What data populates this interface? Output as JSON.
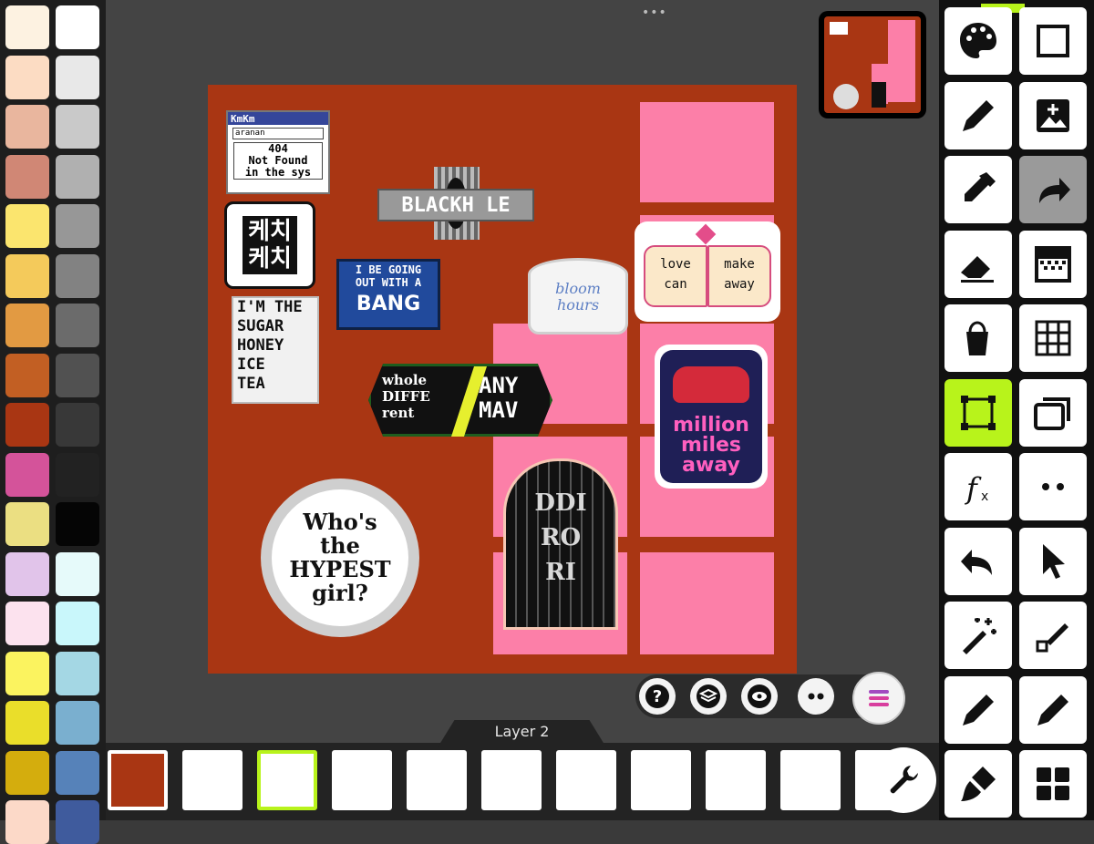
{
  "palette": {
    "colors_left": [
      "#fdf2e1",
      "#fcdcc3",
      "#e9b69e",
      "#d08775",
      "#fbe56e",
      "#f4ca5b",
      "#e29a42",
      "#c25f23",
      "#a93613",
      "#d4539a",
      "#ebdf82",
      "#e1c4ea",
      "#fce2ee",
      "#fbf35f",
      "#eade2a",
      "#d4ad0d",
      "#fcd9c8"
    ],
    "colors_right": [
      "#ffffff",
      "#e8e8e8",
      "#c9c9c9",
      "#b0b0b0",
      "#979797",
      "#828282",
      "#6b6b6b",
      "#515151",
      "#383838",
      "#222222",
      "#050505",
      "#e6fafa",
      "#c9f7fb",
      "#a4d7e4",
      "#7aafcf",
      "#5682b9",
      "#3f5b9d"
    ]
  },
  "canvas": {
    "background": "#a93613",
    "stickers": {
      "window_title": "KmKm",
      "window_field": "aranan",
      "window_text": "404\nNot Found\nin the sys",
      "kechi": "케치\n케치",
      "blackhole": "BLACKH LE",
      "bang_top": "I BE GOING\nOUT WITH A",
      "bang_word": "BANG",
      "sugar": "I'M THE\nSUGAR\nHONEY\nICE\nTEA",
      "whole": "whole\nDIFFE\nrent",
      "anymav": "ANY\nMAV",
      "bloom": "bloom\nhours",
      "book_left": "love\ncan",
      "book_right": "make\naway",
      "million": "million\nmiles\naway",
      "hypest": "Who's\nthe\nHYPEST\ngirl?",
      "gate": "DDI\nRO\nRI"
    }
  },
  "layers": {
    "current_name": "Layer 2",
    "thumbnails": [
      "layer-1",
      "layer-2",
      "layer-3",
      "layer-4",
      "layer-5",
      "layer-6",
      "layer-7",
      "layer-8",
      "layer-9",
      "layer-10",
      "layer-11"
    ],
    "selected_index": 2
  },
  "quick_actions": [
    "help-icon",
    "layers-icon",
    "eye-icon",
    "more-icon",
    "menu-icon"
  ],
  "tools": [
    "palette",
    "rectangle-select",
    "pencil",
    "add-image",
    "eyedropper",
    "redo",
    "eraser",
    "dither",
    "bucket",
    "grid",
    "transform",
    "layers-stack",
    "function",
    "more",
    "undo",
    "pointer",
    "magic-wand",
    "line",
    "pen",
    "pen-alt",
    "brush",
    "tiles"
  ],
  "accent": "#b8f31b"
}
